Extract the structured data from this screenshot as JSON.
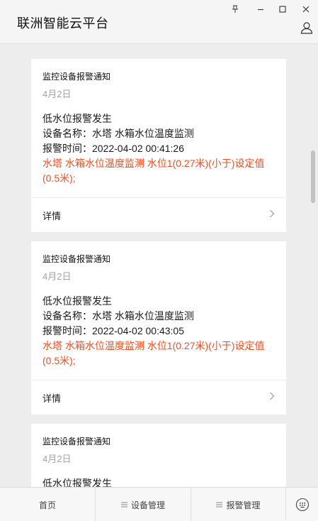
{
  "app": {
    "title": "联洲智能云平台"
  },
  "window_controls": [
    "pin-icon",
    "minimize-icon",
    "maximize-icon",
    "close-icon"
  ],
  "cards": [
    {
      "title": "监控设备报警通知",
      "date": "4月2日",
      "event": "低水位报警发生",
      "device": "设备名称：水塔 水箱水位温度监测",
      "time": "报警时间：2022-04-02 00:41:26",
      "alert": "水塔 水箱水位温度监测 水位1(0.27米)(小于)设定值(0.5米);",
      "detail_label": "详情"
    },
    {
      "title": "监控设备报警通知",
      "date": "4月2日",
      "event": "低水位报警发生",
      "device": "设备名称：水塔 水箱水位温度监测",
      "time": "报警时间：2022-04-02 00:43:05",
      "alert": "水塔 水箱水位温度监测 水位1(0.27米)(小于)设定值(0.5米);",
      "detail_label": "详情"
    },
    {
      "title": "监控设备报警通知",
      "date": "4月2日",
      "event": "低水位报警发生"
    }
  ],
  "bottom_nav": {
    "home": "首页",
    "device_mgmt": "设备管理",
    "alarm_mgmt": "报警管理"
  },
  "colors": {
    "alert": "#f04f22",
    "date": "#a3a3a3",
    "background": "#ededed"
  }
}
